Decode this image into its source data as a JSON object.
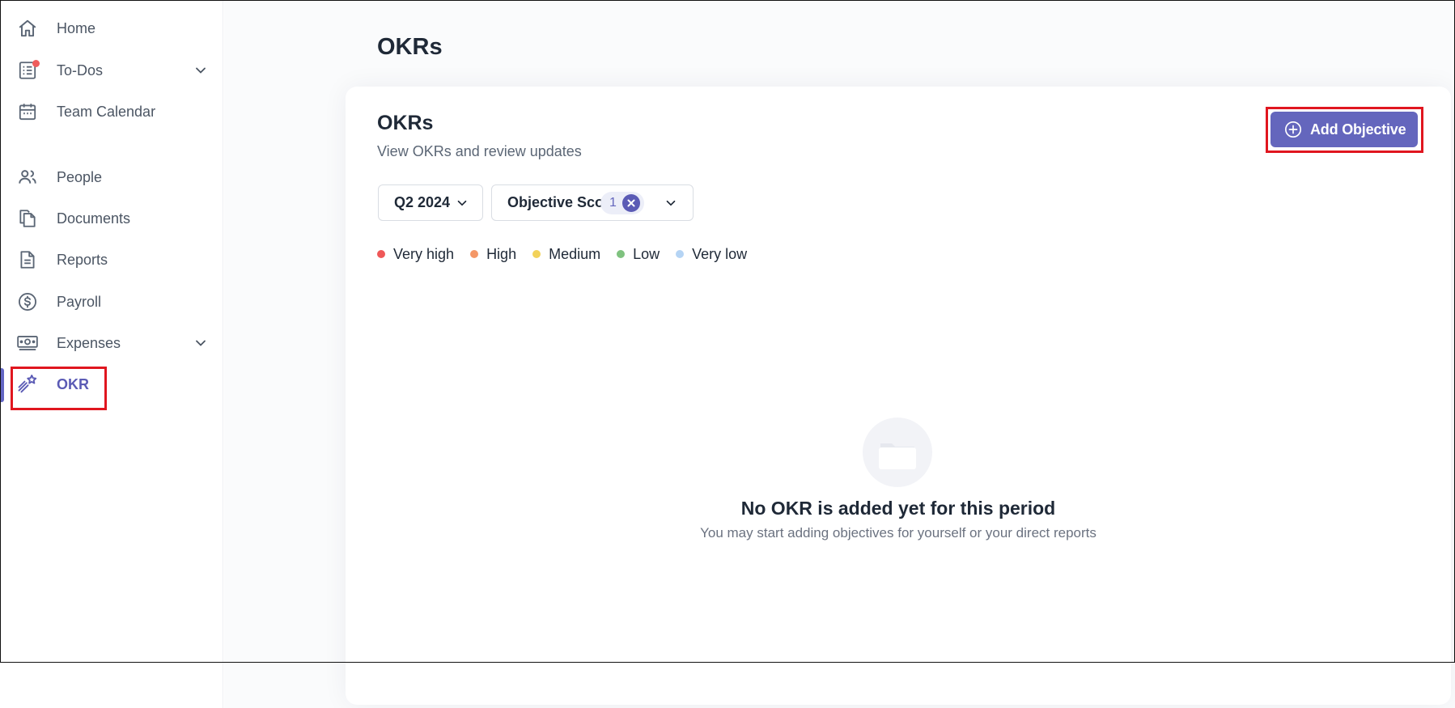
{
  "sidebar": {
    "items": [
      {
        "label": "Home",
        "icon": "home-icon"
      },
      {
        "label": "To-Dos",
        "icon": "todo-list-icon",
        "has_notification": true,
        "expandable": true
      },
      {
        "label": "Team Calendar",
        "icon": "calendar-icon"
      },
      {
        "label": "People",
        "icon": "people-icon"
      },
      {
        "label": "Documents",
        "icon": "documents-icon"
      },
      {
        "label": "Reports",
        "icon": "report-icon"
      },
      {
        "label": "Payroll",
        "icon": "dollar-icon"
      },
      {
        "label": "Expenses",
        "icon": "cash-icon",
        "expandable": true
      },
      {
        "label": "OKR",
        "icon": "shooting-star-icon",
        "active": true
      }
    ]
  },
  "page": {
    "title": "OKRs"
  },
  "card": {
    "title": "OKRs",
    "subtitle": "View OKRs and review updates",
    "add_button_label": "Add Objective"
  },
  "filters": {
    "period": "Q2 2024",
    "scope_label": "Objective Scope",
    "scope_count": "1"
  },
  "legend": [
    {
      "label": "Very high",
      "color": "#ef5858"
    },
    {
      "label": "High",
      "color": "#f49767"
    },
    {
      "label": "Medium",
      "color": "#f2d25a"
    },
    {
      "label": "Low",
      "color": "#7fc27f"
    },
    {
      "label": "Very low",
      "color": "#b5d4f4"
    }
  ],
  "empty_state": {
    "title": "No OKR is added yet for this period",
    "subtitle": "You may start adding objectives for yourself or your direct reports"
  },
  "colors": {
    "accent": "#6466bd",
    "highlight": "#e0161f",
    "notification": "#ef5c5c"
  }
}
